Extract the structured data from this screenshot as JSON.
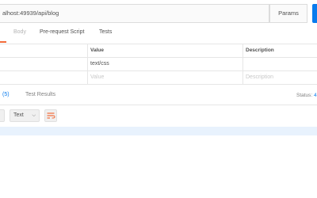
{
  "request": {
    "url": "alhost:49939/api/blog",
    "params_label": "Params",
    "tabs": [
      {
        "label": "Body",
        "state": "disabled"
      },
      {
        "label": "Pre-request Script",
        "state": "normal"
      },
      {
        "label": "Tests",
        "state": "normal"
      }
    ]
  },
  "headers_table": {
    "columns": {
      "value": "Value",
      "description": "Description"
    },
    "rows": [
      {
        "key": "",
        "value": "text/css",
        "description": ""
      }
    ],
    "placeholder": {
      "value": "Value",
      "description": "Description"
    }
  },
  "response": {
    "headers_count": "(5)",
    "test_results_label": "Test Results",
    "status_label": "Status:",
    "status_value": "4",
    "format_select": "Text"
  },
  "colors": {
    "accent_orange": "#f26b3a",
    "accent_blue": "#097bed",
    "highlight_line": "#e8f2fd"
  }
}
